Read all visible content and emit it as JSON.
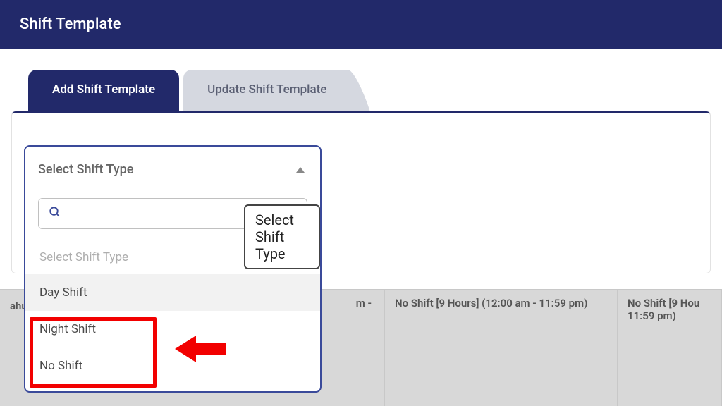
{
  "header": {
    "title": "Shift Template"
  },
  "tabs": {
    "add": "Add Shift Template",
    "update": "Update Shift Template"
  },
  "dropdown": {
    "label": "Select Shift Type",
    "tooltip": "Select Shift Type",
    "search_placeholder": "",
    "placeholder_option": "Select Shift Type",
    "options": [
      {
        "label": "Day Shift",
        "highlighted": true
      },
      {
        "label": "Night Shift",
        "highlighted": false
      },
      {
        "label": "No Shift",
        "highlighted": false
      }
    ]
  },
  "calendar": {
    "row_label": "ahul",
    "cell_partial": "m -",
    "cell_full": "No Shift [9 Hours] (12:00 am - 11:59 pm)",
    "cell_truncated_a": "No Shift [9 Hou",
    "cell_truncated_b": "11:59 pm)"
  }
}
